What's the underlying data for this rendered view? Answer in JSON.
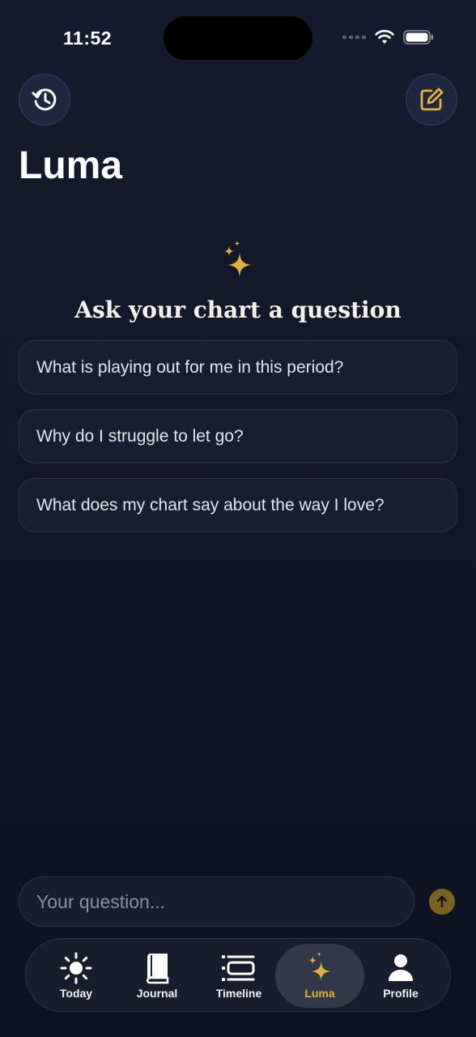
{
  "status_bar": {
    "time": "11:52"
  },
  "header": {
    "title": "Luma",
    "history_icon": "history-icon",
    "compose_icon": "compose-icon"
  },
  "hero": {
    "icon": "sparkles-icon",
    "title": "Ask your chart a question"
  },
  "suggestions": [
    {
      "label": "What is playing out for me in this period?"
    },
    {
      "label": "Why do I struggle to let go?"
    },
    {
      "label": "What does my chart say about the way I love?"
    }
  ],
  "composer": {
    "placeholder": "Your question...",
    "value": "",
    "send_icon": "arrow-up-icon"
  },
  "tabs": [
    {
      "label": "Today",
      "icon": "sun-icon",
      "active": false
    },
    {
      "label": "Journal",
      "icon": "book-icon",
      "active": false
    },
    {
      "label": "Timeline",
      "icon": "timeline-icon",
      "active": false
    },
    {
      "label": "Luma",
      "icon": "sparkles-icon",
      "active": true
    },
    {
      "label": "Profile",
      "icon": "person-icon",
      "active": false
    }
  ],
  "colors": {
    "accent_gold": "#e2b33b",
    "background": "#121729",
    "card": "#181e31"
  }
}
